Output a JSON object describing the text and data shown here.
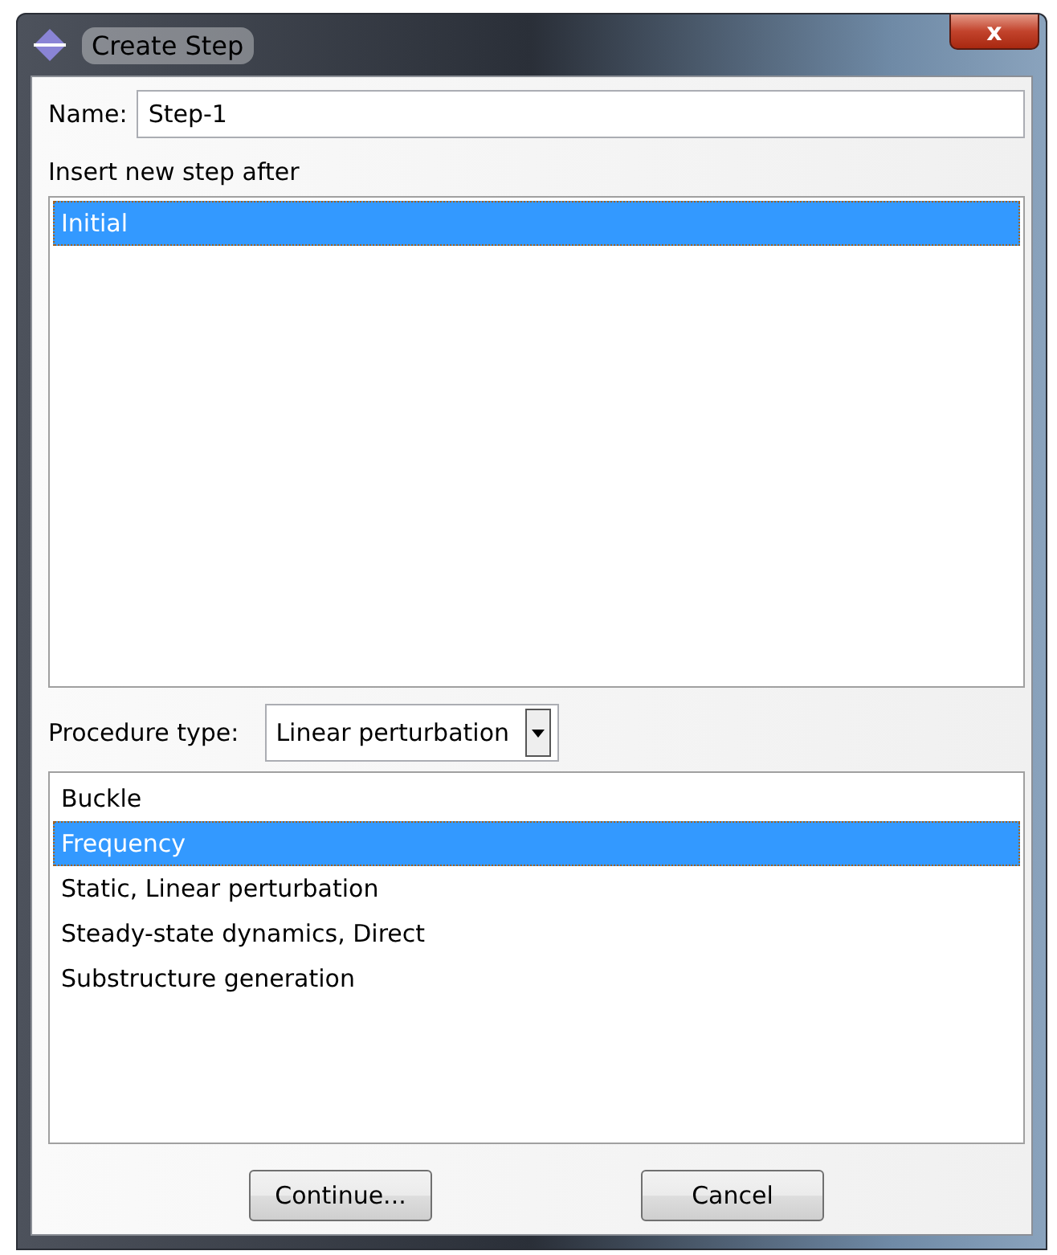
{
  "window": {
    "title": "Create Step",
    "close": "x"
  },
  "name_field": {
    "label": "Name:",
    "value": "Step-1"
  },
  "insert_after": {
    "label": "Insert new step after",
    "items": [
      {
        "label": "Initial",
        "selected": true
      }
    ]
  },
  "procedure_type": {
    "label": "Procedure type:",
    "value": "Linear perturbation"
  },
  "procedures": [
    {
      "label": "Buckle",
      "selected": false
    },
    {
      "label": "Frequency",
      "selected": true
    },
    {
      "label": "Static, Linear perturbation",
      "selected": false
    },
    {
      "label": "Steady-state dynamics, Direct",
      "selected": false
    },
    {
      "label": "Substructure generation",
      "selected": false
    }
  ],
  "buttons": [
    "Continue...",
    "Cancel"
  ]
}
